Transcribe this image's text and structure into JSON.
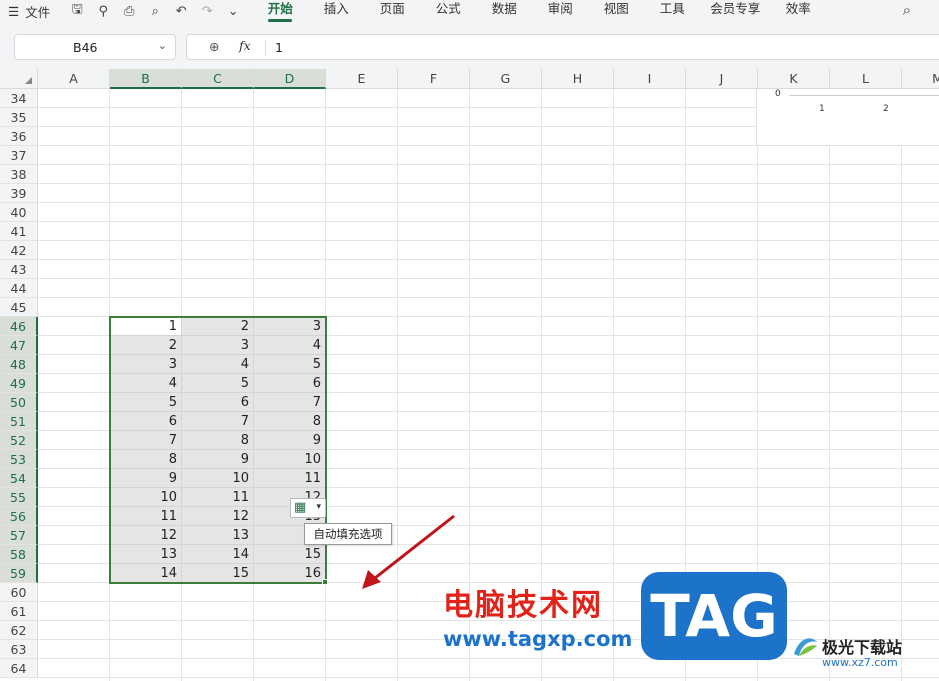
{
  "menubar": {
    "file_icon": "hamburger-icon",
    "file_label": "文件",
    "quick_access": [
      "save-icon",
      "link-icon",
      "print-icon",
      "print-preview-icon",
      "undo-icon",
      "redo-icon",
      "more-icon"
    ],
    "tabs": [
      "开始",
      "插入",
      "页面",
      "公式",
      "数据",
      "审阅",
      "视图",
      "工具",
      "会员专享",
      "效率"
    ],
    "active_tab": "开始"
  },
  "formula_bar": {
    "name_box": "B46",
    "fx_symbol": "fx",
    "value": "1"
  },
  "sheet": {
    "columns": [
      "A",
      "B",
      "C",
      "D",
      "E",
      "F",
      "G",
      "H",
      "I",
      "J",
      "K",
      "L",
      "M"
    ],
    "selected_columns": [
      "B",
      "C",
      "D"
    ],
    "rows": [
      "34",
      "35",
      "36",
      "37",
      "38",
      "39",
      "40",
      "41",
      "42",
      "43",
      "44",
      "45",
      "46",
      "47",
      "48",
      "49",
      "50",
      "51",
      "52",
      "53",
      "54",
      "55",
      "56",
      "57",
      "58",
      "59",
      "60",
      "61",
      "62",
      "63",
      "64"
    ],
    "selected_rows": [
      "46",
      "47",
      "48",
      "49",
      "50",
      "51",
      "52",
      "53",
      "54",
      "55",
      "56",
      "57",
      "58",
      "59"
    ],
    "data": [
      [
        "1",
        "2",
        "3"
      ],
      [
        "2",
        "3",
        "4"
      ],
      [
        "3",
        "4",
        "5"
      ],
      [
        "4",
        "5",
        "6"
      ],
      [
        "5",
        "6",
        "7"
      ],
      [
        "6",
        "7",
        "8"
      ],
      [
        "7",
        "8",
        "9"
      ],
      [
        "8",
        "9",
        "10"
      ],
      [
        "9",
        "10",
        "11"
      ],
      [
        "10",
        "11",
        "12"
      ],
      [
        "11",
        "12",
        "13"
      ],
      [
        "12",
        "13",
        "14"
      ],
      [
        "13",
        "14",
        "15"
      ],
      [
        "14",
        "15",
        "16"
      ]
    ],
    "active_cell": "B46"
  },
  "chart_fragment": {
    "y_zero": "0",
    "x_ticks": [
      "1",
      "2"
    ]
  },
  "autofill": {
    "icon": "autofill-options-icon",
    "tooltip": "自动填充选项"
  },
  "watermark": {
    "text": "电脑技术网",
    "url": "www.tagxp.com",
    "tag": "TAG",
    "site_name": "极光下载站",
    "site_url": "www.xz7.com"
  },
  "colors": {
    "accent": "#1e6f44",
    "selection_border": "#3b7d3a",
    "arrow": "#c0161b"
  }
}
